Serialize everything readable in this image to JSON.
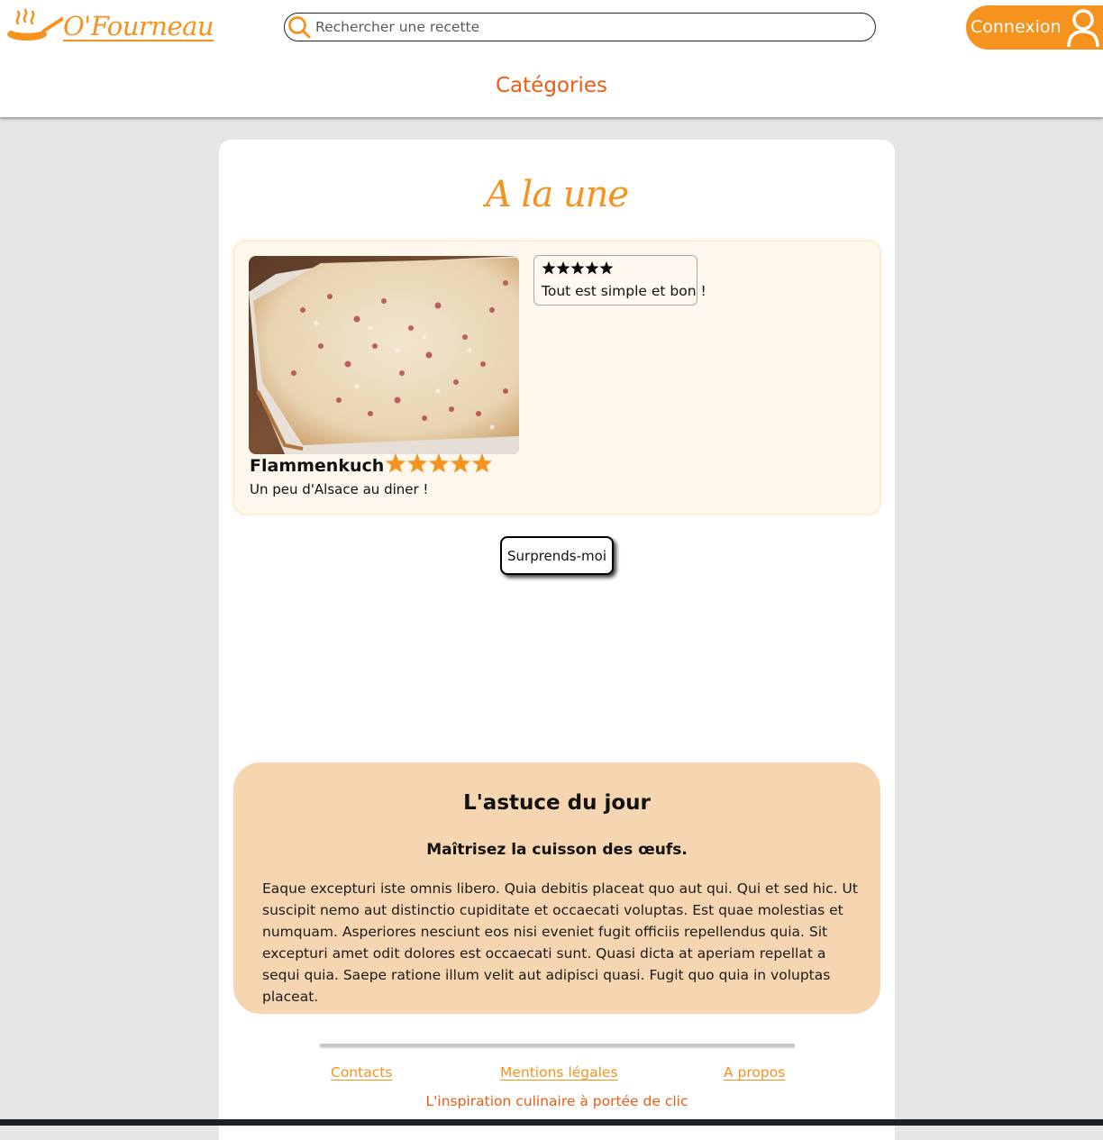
{
  "header": {
    "logo_text": "O'Fourneau",
    "search_placeholder": "Rechercher une recette",
    "login_label": "Connexion",
    "categories_label": "Catégories"
  },
  "featured": {
    "section_title": "A la une",
    "recipe": {
      "name": "Flammenkuch",
      "description": "Un peu d'Alsace au diner !",
      "rating": 5,
      "rating_max": 5
    },
    "review": {
      "rating": 5,
      "text": "Tout est simple et bon !"
    },
    "surprise_label": "Surprends-moi"
  },
  "tip": {
    "title": "L'astuce du jour",
    "subtitle": "Maîtrisez la cuisson des œufs.",
    "body": "Eaque excepturi iste omnis libero. Quia debitis placeat quo aut qui. Qui et sed hic. Ut suscipit nemo aut distinctio cupiditate et occaecati voluptas. Est quae molestias et numquam. Asperiores nesciunt eos nisi eveniet fugit officiis repellendus quia. Sit excepturi amet odit dolores est occaecati sunt. Quasi dicta at aperiam repellat a sequi quia. Saepe ratione illum velit aut adipisci quasi. Fugit quo quia in voluptas placeat."
  },
  "footer": {
    "links": [
      "Contacts",
      "Mentions légales",
      "A propos"
    ],
    "tagline": "L'inspiration culinaire à portée de clic"
  },
  "colors": {
    "brand_orange": "#f6921e",
    "accent_orange": "#ee5c12",
    "tip_background": "#f6d6b0",
    "featured_background": "#fef7ec"
  },
  "icons": [
    "pan-logo-icon",
    "search-icon",
    "user-icon",
    "star-icon"
  ]
}
